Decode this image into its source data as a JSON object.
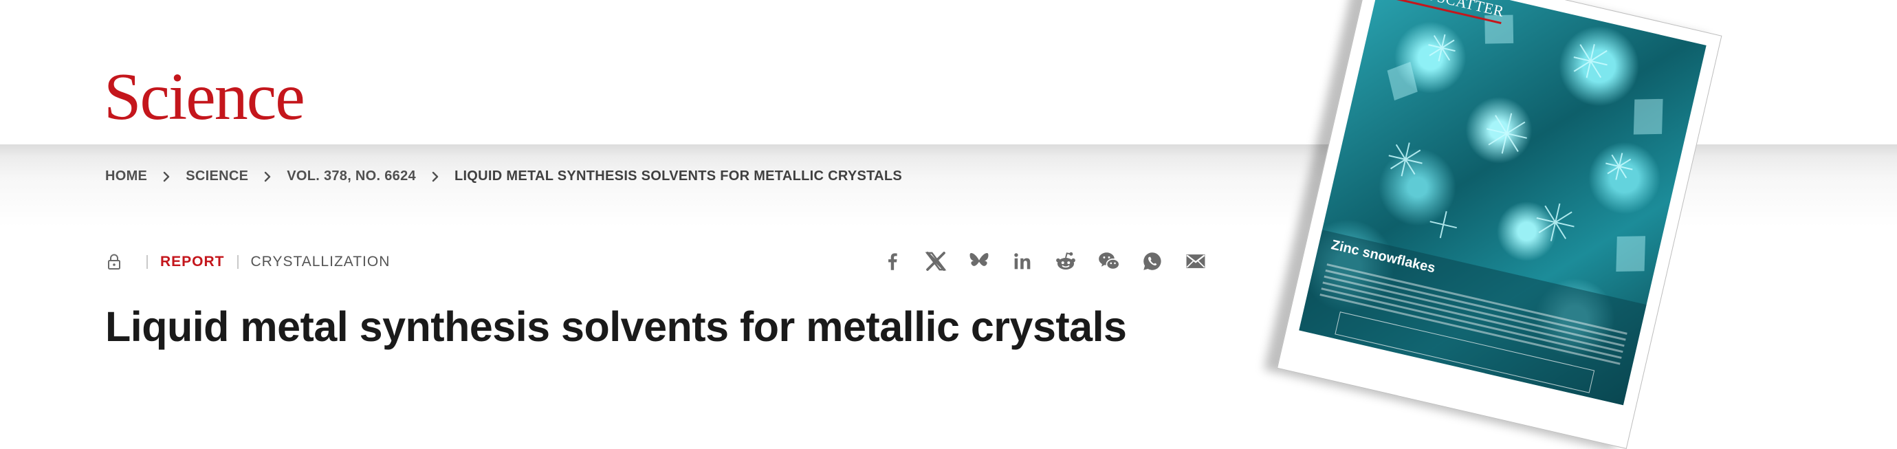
{
  "logo": {
    "text": "Science"
  },
  "breadcrumb": {
    "items": [
      "HOME",
      "SCIENCE",
      "VOL. 378, NO. 6624"
    ],
    "current": "LIQUID METAL SYNTHESIS SOLVENTS FOR METALLIC CRYSTALS"
  },
  "meta": {
    "access_icon": "lock-icon",
    "article_type": "REPORT",
    "topic": "CRYSTALLIZATION"
  },
  "share": {
    "icons": [
      "facebook-icon",
      "x-icon",
      "bluesky-icon",
      "linkedin-icon",
      "reddit-icon",
      "wechat-icon",
      "whatsapp-icon",
      "email-icon"
    ]
  },
  "article": {
    "title": "Liquid metal synthesis solvents for metallic crystals"
  },
  "cover": {
    "label": "BACK SCATTER",
    "headline": "Zinc snowflakes"
  },
  "colors": {
    "brand": "#c4161c",
    "text": "#1a1a1a",
    "muted": "#505050",
    "icon": "#6b6b6b",
    "cover_teal": "#2aa5b2"
  }
}
